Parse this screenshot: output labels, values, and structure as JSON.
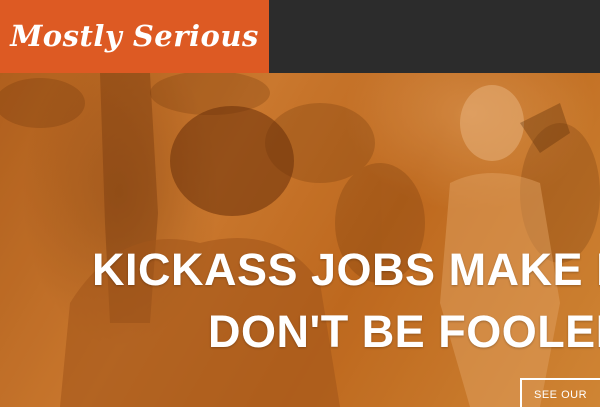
{
  "brand": {
    "logo_text": "Mostly Serious",
    "color": "#dd5a23"
  },
  "header": {
    "background": "#2c2c2c"
  },
  "hero": {
    "headline_line1": "KICKASS JOBS MAKE FO",
    "headline_line2": "DON'T BE FOOLED",
    "cta_label": "SEE OUR",
    "overlay_color": "#c8762d"
  }
}
